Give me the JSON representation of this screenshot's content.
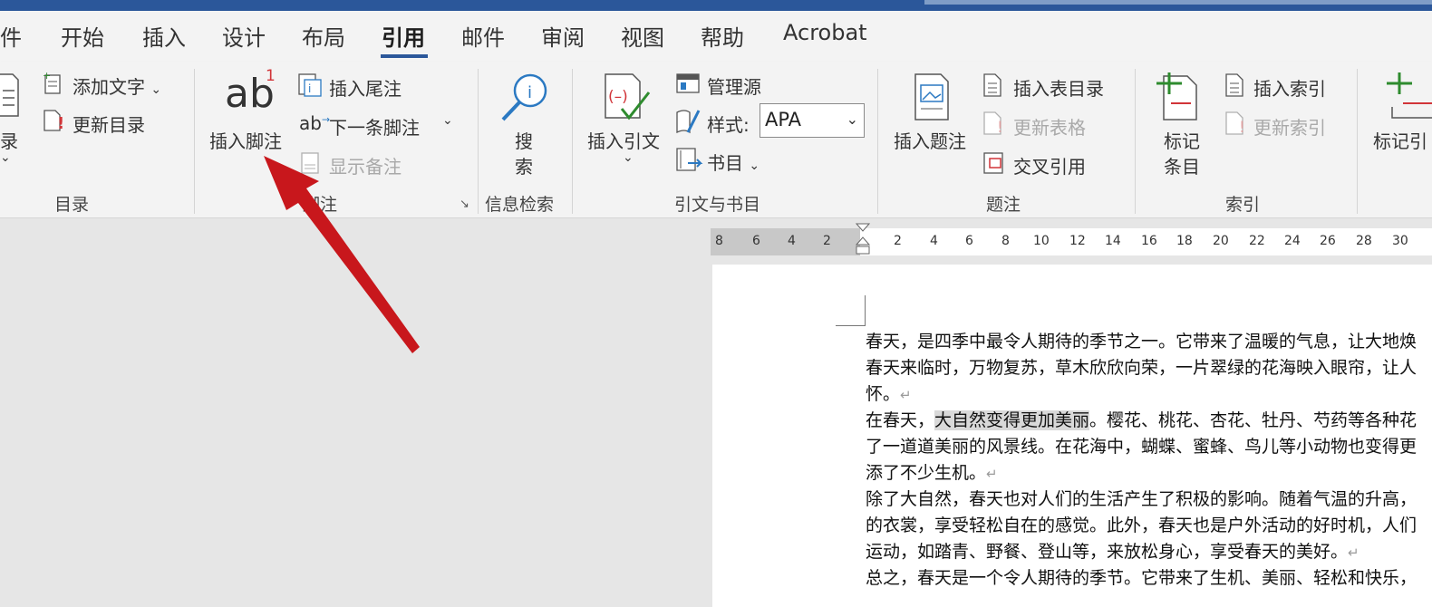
{
  "tabs": [
    "件",
    "开始",
    "插入",
    "设计",
    "布局",
    "引用",
    "邮件",
    "审阅",
    "视图",
    "帮助",
    "Acrobat"
  ],
  "active_tab": "引用",
  "ribbon": {
    "toc": {
      "big_label": "录",
      "add_text": "添加文字",
      "update_toc": "更新目录",
      "group": "目录"
    },
    "footnotes": {
      "insert_footnote": "插入脚注",
      "insert_endnote": "插入尾注",
      "next_footnote": "下一条脚注",
      "show_notes": "显示备注",
      "group": "脚注"
    },
    "research": {
      "search": "搜",
      "search2": "索",
      "group": "信息检索"
    },
    "citations": {
      "insert_citation": "插入引文",
      "manage_sources": "管理源",
      "style_label": "样式:",
      "style_value": "APA",
      "bibliography": "书目",
      "group": "引文与书目"
    },
    "captions": {
      "insert_caption": "插入题注",
      "insert_table_of_figures": "插入表目录",
      "update_table": "更新表格",
      "cross_reference": "交叉引用",
      "group": "题注"
    },
    "index": {
      "mark_entry_1": "标记",
      "mark_entry_2": "条目",
      "insert_index": "插入索引",
      "update_index": "更新索引",
      "group": "索引"
    },
    "toa": {
      "mark_citation": "标记引"
    }
  },
  "ruler_numbers": [
    "8",
    "6",
    "4",
    "2",
    "2",
    "4",
    "6",
    "8",
    "10",
    "12",
    "14",
    "16",
    "18",
    "20",
    "22",
    "24",
    "26",
    "28",
    "30"
  ],
  "document": {
    "lines": [
      "春天，是四季中最令人期待的季节之一。它带来了温暖的气息，让大地焕",
      "春天来临时，万物复苏，草木欣欣向荣，一片翠绿的花海映入眼帘，让人",
      "怀。",
      "在春天，",
      "大自然变得更加美丽",
      "。樱花、桃花、杏花、牡丹、芍药等各种花",
      "了一道道美丽的风景线。在花海中，蝴蝶、蜜蜂、鸟儿等小动物也变得更",
      "添了不少生机。",
      "除了大自然，春天也对人们的生活产生了积极的影响。随着气温的升高，",
      "的衣裳，享受轻松自在的感觉。此外，春天也是户外活动的好时机，人们",
      "运动，如踏青、野餐、登山等，来放松身心，享受春天的美好。",
      "总之，春天是一个令人期待的季节。它带来了生机、美丽、轻松和快乐，"
    ],
    "paragraph_mark": "↵"
  },
  "colors": {
    "title_bar": "#2b579a",
    "arrow": "#c8171c",
    "footnote_superscript": "#d13438"
  }
}
